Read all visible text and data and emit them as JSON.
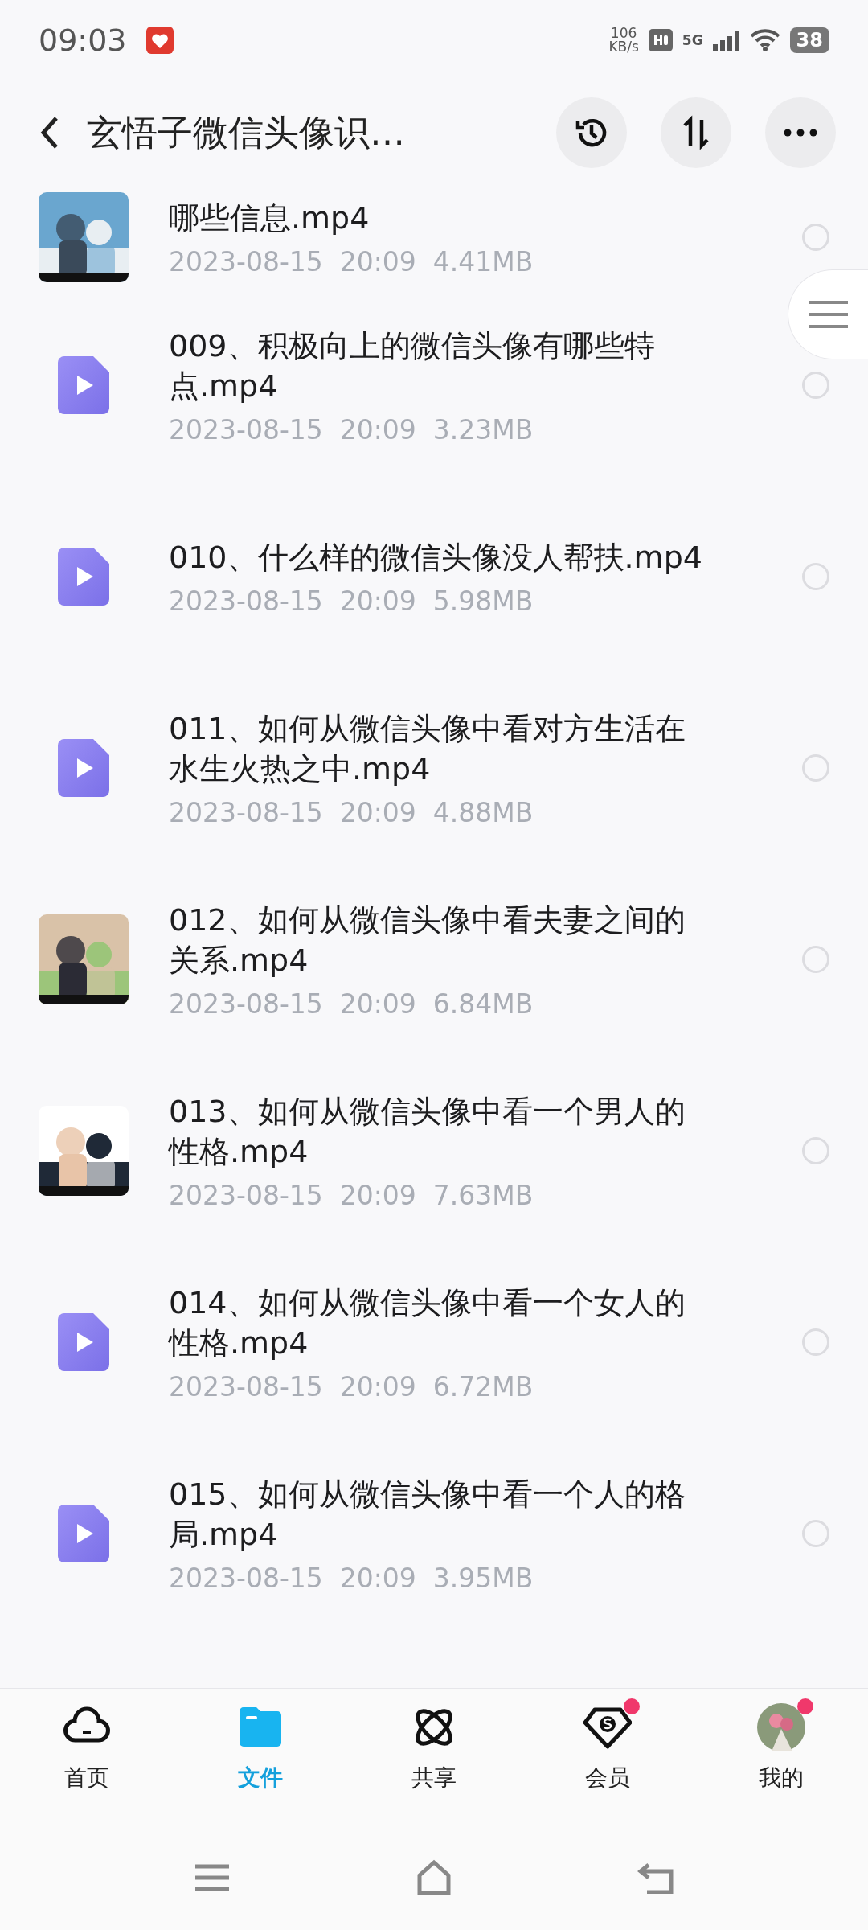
{
  "status_bar": {
    "time": "09:03",
    "speed": "106",
    "speed_unit": "KB/s",
    "network": "5G",
    "battery": "38"
  },
  "header": {
    "title": "玄悟子微信头像识…"
  },
  "files": [
    {
      "kind": "picture",
      "name": "哪些信息.mp4",
      "date": "2023-08-15",
      "time": "20:09",
      "size": "4.41MB",
      "selected": false
    },
    {
      "kind": "video",
      "name": "009、积极向上的微信头像有哪些特点.mp4",
      "date": "2023-08-15",
      "time": "20:09",
      "size": "3.23MB",
      "selected": false
    },
    {
      "kind": "video",
      "name": "010、什么样的微信头像没人帮扶.mp4",
      "date": "2023-08-15",
      "time": "20:09",
      "size": "5.98MB",
      "selected": false
    },
    {
      "kind": "video",
      "name": "011、如何从微信头像中看对方生活在水生火热之中.mp4",
      "date": "2023-08-15",
      "time": "20:09",
      "size": "4.88MB",
      "selected": false
    },
    {
      "kind": "picture",
      "name": "012、如何从微信头像中看夫妻之间的关系.mp4",
      "date": "2023-08-15",
      "time": "20:09",
      "size": "6.84MB",
      "selected": false
    },
    {
      "kind": "picture",
      "name": "013、如何从微信头像中看一个男人的性格.mp4",
      "date": "2023-08-15",
      "time": "20:09",
      "size": "7.63MB",
      "selected": false
    },
    {
      "kind": "video",
      "name": "014、如何从微信头像中看一个女人的性格.mp4",
      "date": "2023-08-15",
      "time": "20:09",
      "size": "6.72MB",
      "selected": false
    },
    {
      "kind": "video",
      "name": "015、如何从微信头像中看一个人的格局.mp4",
      "date": "2023-08-15",
      "time": "20:09",
      "size": "3.95MB",
      "selected": false
    }
  ],
  "tabs": [
    {
      "kind": "home",
      "label": "首页",
      "selected": false,
      "badge": false
    },
    {
      "kind": "files",
      "label": "文件",
      "selected": true,
      "badge": false
    },
    {
      "kind": "share",
      "label": "共享",
      "selected": false,
      "badge": false
    },
    {
      "kind": "vip",
      "label": "会员",
      "selected": false,
      "badge": true
    },
    {
      "kind": "me",
      "label": "我的",
      "selected": false,
      "badge": true
    }
  ]
}
